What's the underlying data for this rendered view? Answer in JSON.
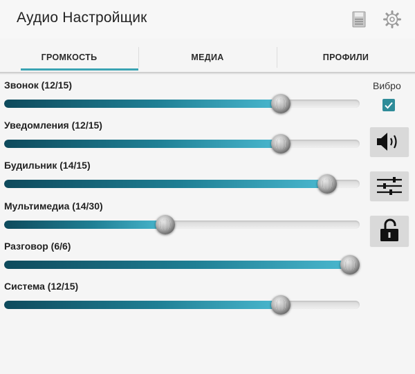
{
  "app": {
    "title": "Аудио Настройщик"
  },
  "header": {
    "icons": [
      "save-icon",
      "gear-icon"
    ]
  },
  "tabs": [
    {
      "label": "ГРОМКОСТЬ",
      "active": true
    },
    {
      "label": "МЕДИА",
      "active": false
    },
    {
      "label": "ПРОФИЛИ",
      "active": false
    }
  ],
  "sliders": [
    {
      "label": "Звонок (12/15)",
      "value": 12,
      "max": 15
    },
    {
      "label": "Уведомления (12/15)",
      "value": 12,
      "max": 15
    },
    {
      "label": "Будильник (14/15)",
      "value": 14,
      "max": 15
    },
    {
      "label": "Мультимедиа (14/30)",
      "value": 14,
      "max": 30
    },
    {
      "label": "Разговор (6/6)",
      "value": 6,
      "max": 6
    },
    {
      "label": "Система (12/15)",
      "value": 12,
      "max": 15
    }
  ],
  "side": {
    "vibro_label": "Вибро",
    "vibro_checked": true,
    "buttons": [
      "speaker-icon",
      "equalizer-icon",
      "unlock-icon"
    ]
  },
  "colors": {
    "accent": "#3aa3b3",
    "fill_start": "#0e4a5c",
    "fill_end": "#4ab8cf",
    "checkbox": "#2f8c99"
  }
}
